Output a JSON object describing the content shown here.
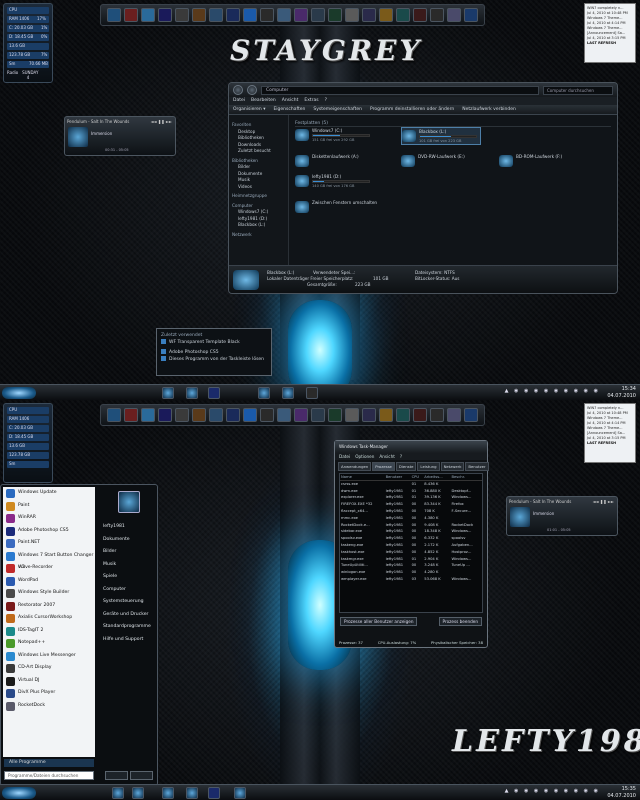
{
  "top": {
    "logo_text": "STAYGREY",
    "cpu_gadget": {
      "rows": [
        {
          "label": "CPU",
          "value": ""
        },
        {
          "label": "RAM 1406",
          "value": "17%"
        },
        {
          "label": "C: 20.03 GB",
          "value": "1%"
        },
        {
          "label": "D: 18.45 GB",
          "value": "0%"
        },
        {
          "label": "13.6 GB",
          "value": ""
        },
        {
          "label": "123.78 GB",
          "value": "7%"
        },
        {
          "label": "Sm",
          "value": "70.66 MB"
        }
      ],
      "day_label": "Radio",
      "day": "SUNDAY",
      "day_num": "4"
    },
    "feed": {
      "items": [
        "WIN7 completely n...",
        "Jul 4, 2010 at 10:48 PM",
        "Windows 7 Theme...",
        "Jul 4, 2010 at 4:14 PM",
        "Windows 7 Theme...",
        "[Announcement] Sa...",
        "Jul 4, 2010 at 3:15 PM",
        "LAST REFRESH"
      ]
    },
    "player": {
      "title": "Pendulum - Salt In The Wounds",
      "track": "Immersion",
      "time": "00:31 - 05:05"
    },
    "explorer": {
      "address": "Computer",
      "search_placeholder": "Computer durchsuchen",
      "menu": [
        "Datei",
        "Bearbeiten",
        "Ansicht",
        "Extras",
        "?"
      ],
      "commands": [
        "Organisieren ▾",
        "Eigenschaften",
        "Systemeigenschaften",
        "Programm deinstallieren oder ändern",
        "Netzlaufwerk verbinden"
      ],
      "nav_groups": [
        {
          "title": "Favoriten",
          "items": [
            "Desktop",
            "Bibliotheken",
            "Downloads",
            "Zuletzt besucht"
          ]
        },
        {
          "title": "Bibliotheken",
          "items": [
            "Bilder",
            "Dokumente",
            "Musik",
            "Videos"
          ]
        },
        {
          "title": "Heimnetzgruppe",
          "items": []
        },
        {
          "title": "Computer",
          "items": [
            "Windows7 (C:)",
            "lefty1981 (D:)",
            "Blackbox (L:)"
          ]
        },
        {
          "title": "Netzwerk",
          "items": []
        }
      ],
      "section": "Festplatten (5)",
      "drives": [
        {
          "name": "Windows7 (C:)",
          "free": "151 GB frei von 292 GB",
          "fill": 0.48
        },
        {
          "name": "Blackbox (L:)",
          "free": "101 GB frei von 223 GB",
          "fill": 0.55
        },
        {
          "name": "lefty1981 (D:)",
          "free": "140 GB frei von 176 GB",
          "fill": 0.2
        },
        {
          "name": "Diskettenlaufwerk (A:)",
          "free": "",
          "fill": 0
        },
        {
          "name": "DVD-RW-Laufwerk (E:)",
          "free": "",
          "fill": 0
        },
        {
          "name": "BD-ROM-Laufwerk (F:)",
          "free": "",
          "fill": 0
        },
        {
          "name": "Zwischen Fenstern umschalten",
          "free": "",
          "fill": 0
        }
      ],
      "status": {
        "name": "Blackbox (L:)",
        "used_label": "Verwendeter Spei...:",
        "total_label": "Lokaler Datenträger  Freier Speicherplatz:",
        "free": "101 GB",
        "size_label": "Gesamtgröße:",
        "size": "223 GB",
        "fs_label": "Dateisystem:",
        "fs": "NTFS",
        "bl_label": "BitLocker-Status:",
        "bl": "Aus"
      }
    },
    "jumplist": {
      "heading": "Zuletzt verwendet",
      "recent": [
        "WF Transparent Template Black"
      ],
      "app": "Adobe Photoshop CS5",
      "unpin": "Dieses Programm von der Taskleiste lösen"
    },
    "clock": {
      "time": "15:34",
      "date": "04.07.2010"
    }
  },
  "bottom": {
    "logo_text": "LEFTY1981",
    "start_menu": {
      "programs": [
        "Windows Update",
        "Paint",
        "WinRAR",
        "Adobe Photoshop CS5",
        "Paint.NET",
        "Windows 7 Start Button Changer v 2",
        "Wave-Recorder",
        "WordPad",
        "Windows Style Builder",
        "Restorator 2007",
        "Axialis CursorWorkshop",
        "IDS-TagIT 2",
        "Notepad++",
        "Windows Live Messenger",
        "CD-Art Display",
        "Virtual DJ",
        "DivX Plus Player",
        "RocketDock"
      ],
      "all_programs": "Alle Programme",
      "search_placeholder": "Programme/Dateien durchsuchen",
      "right_items": [
        "lefty1981",
        "Dokumente",
        "Bilder",
        "Musik",
        "Spiele",
        "Computer",
        "Systemsteuerung",
        "Geräte und Drucker",
        "Standardprogramme",
        "Hilfe und Support"
      ]
    },
    "taskmgr": {
      "title": "Windows Task-Manager",
      "menu": [
        "Datei",
        "Optionen",
        "Ansicht",
        "?"
      ],
      "tabs": [
        "Anwendungen",
        "Prozesse",
        "Dienste",
        "Leistung",
        "Netzwerk",
        "Benutzer"
      ],
      "columns": [
        "Name",
        "Benutzer",
        "CPU",
        "Arbeitss...",
        "Beschr."
      ],
      "rows": [
        [
          "csrss.exe",
          "",
          "01",
          "8.436 K",
          ""
        ],
        [
          "dwm.exe",
          "lefty1981",
          "01",
          "36.880 K",
          "Desktopf..."
        ],
        [
          "explorer.exe",
          "lefty1981",
          "01",
          "39.136 K",
          "Windows..."
        ],
        [
          "FIREFOX.EXE *32",
          "lefty1981",
          "00",
          "83.344 K",
          "Firefox"
        ],
        [
          "flaccept_x64...",
          "lefty1981",
          "00",
          "708 K",
          "F-Secure..."
        ],
        [
          "mmc.exe",
          "lefty1981",
          "00",
          "4.380 K",
          ""
        ],
        [
          "RocketDock.e...",
          "lefty1981",
          "00",
          "9.408 K",
          "RocketDock"
        ],
        [
          "sidebar.exe",
          "lefty1981",
          "00",
          "18.348 K",
          "Windows..."
        ],
        [
          "spoolsv.exe",
          "lefty1981",
          "00",
          "6.332 K",
          "spoolsv"
        ],
        [
          "taskeng.exe",
          "lefty1981",
          "00",
          "2.172 K",
          "Aufgaben..."
        ],
        [
          "taskhost.exe",
          "lefty1981",
          "00",
          "4.852 K",
          "Hostproz..."
        ],
        [
          "taskmgr.exe",
          "lefty1981",
          "01",
          "2.904 K",
          "Windows..."
        ],
        [
          "TuneUpUtiliti...",
          "lefty1981",
          "00",
          "3.248 K",
          "TuneUp ..."
        ],
        [
          "winlogon.exe",
          "lefty1981",
          "00",
          "4.280 K",
          ""
        ],
        [
          "wmplayer.exe",
          "lefty1981",
          "03",
          "53.068 K",
          "Windows..."
        ]
      ],
      "show_all": "Prozesse aller Benutzer anzeigen",
      "end_process": "Prozess beenden",
      "status": [
        "Prozesse: 37",
        "CPU-Auslastung: 7%",
        "Physikalischer Speicher: 38"
      ]
    },
    "player": {
      "title": "Pendulum - Salt In The Wounds",
      "track": "Immersion",
      "time": "01:01 - 05:05"
    },
    "clock": {
      "time": "15:35",
      "date": "04.07.2010"
    }
  }
}
